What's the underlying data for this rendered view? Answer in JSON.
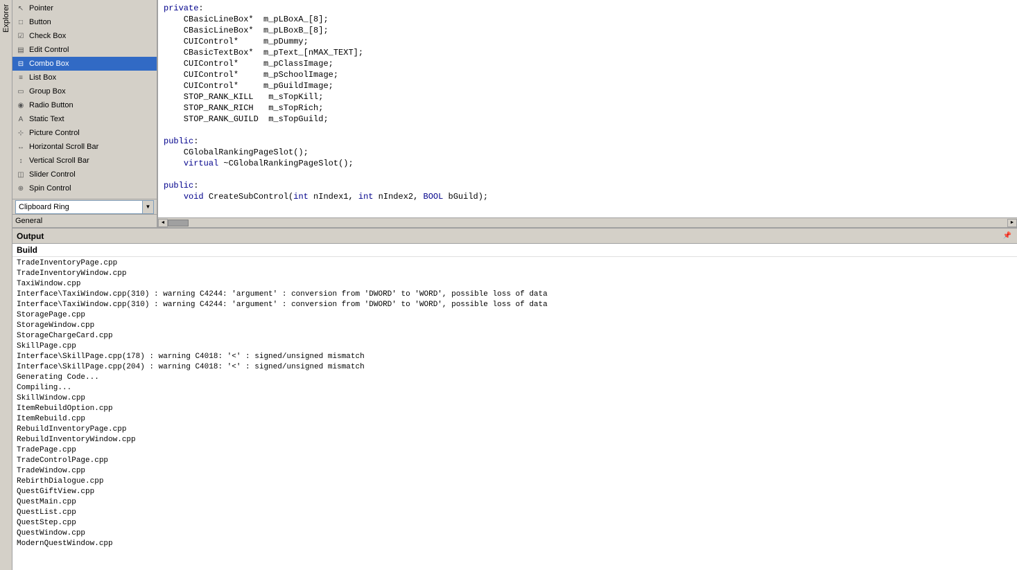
{
  "sidebar": {
    "items": [
      {
        "id": "pointer",
        "label": "Pointer",
        "icon": "↖",
        "selected": false
      },
      {
        "id": "button",
        "label": "Button",
        "icon": "□",
        "selected": false
      },
      {
        "id": "check-box",
        "label": "Check Box",
        "icon": "☑",
        "selected": false
      },
      {
        "id": "edit-control",
        "label": "Edit Control",
        "icon": "▤",
        "selected": false
      },
      {
        "id": "combo-box",
        "label": "Combo Box",
        "icon": "⊟",
        "selected": true
      },
      {
        "id": "list-box",
        "label": "List Box",
        "icon": "≡",
        "selected": false
      },
      {
        "id": "group-box",
        "label": "Group Box",
        "icon": "▭",
        "selected": false
      },
      {
        "id": "radio-button",
        "label": "Radio Button",
        "icon": "◉",
        "selected": false
      },
      {
        "id": "static-text",
        "label": "Static Text",
        "icon": "A",
        "selected": false
      },
      {
        "id": "picture-control",
        "label": "Picture Control",
        "icon": "⊹",
        "selected": false
      },
      {
        "id": "horizontal-scroll",
        "label": "Horizontal Scroll Bar",
        "icon": "↔",
        "selected": false
      },
      {
        "id": "vertical-scroll",
        "label": "Vertical Scroll Bar",
        "icon": "↕",
        "selected": false
      },
      {
        "id": "slider-control",
        "label": "Slider Control",
        "icon": "◫",
        "selected": false
      },
      {
        "id": "spin-control",
        "label": "Spin Control",
        "icon": "⊕",
        "selected": false
      }
    ],
    "clipboard_ring_label": "Clipboard Ring",
    "clipboard_ring_value": "Clipboard Ring",
    "general_label": "General",
    "left_tab": "Explorer"
  },
  "code": {
    "lines": [
      {
        "type": "keyword",
        "text": "private:"
      },
      {
        "type": "normal",
        "text": "    CBasicLineBox*  m_pLBoxA_[8];"
      },
      {
        "type": "normal",
        "text": "    CBasicLineBox*  m_pLBoxB_[8];"
      },
      {
        "type": "normal",
        "text": "    CUIControl*     m_pDummy;"
      },
      {
        "type": "normal",
        "text": "    CBasicTextBox*  m_pText_[nMAX_TEXT];"
      },
      {
        "type": "normal",
        "text": "    CUIControl*     m_pClassImage;"
      },
      {
        "type": "normal",
        "text": "    CUIControl*     m_pSchoolImage;"
      },
      {
        "type": "normal",
        "text": "    CUIControl*     m_pGuildImage;"
      },
      {
        "type": "normal",
        "text": "    STOP_RANK_KILL   m_sTopKill;"
      },
      {
        "type": "normal",
        "text": "    STOP_RANK_RICH   m_sTopRich;"
      },
      {
        "type": "normal",
        "text": "    STOP_RANK_GUILD  m_sTopGuild;"
      },
      {
        "type": "blank",
        "text": ""
      },
      {
        "type": "keyword",
        "text": "public:"
      },
      {
        "type": "normal",
        "text": "    CGlobalRankingPageSlot();"
      },
      {
        "type": "normal",
        "text": "    virtual ~CGlobalRankingPageSlot();"
      },
      {
        "type": "blank",
        "text": ""
      },
      {
        "type": "keyword",
        "text": "public:"
      },
      {
        "type": "normal",
        "text": "    void CreateSubControl(int nIndex1, int nIndex2, BOOL bGuild);"
      }
    ]
  },
  "output": {
    "title": "Output",
    "build_label": "Build",
    "pin_icon": "📌",
    "log_lines": [
      "TradeInventoryPage.cpp",
      "TradeInventoryWindow.cpp",
      "TaxiWindow.cpp",
      "Interface\\TaxiWindow.cpp(310) : warning C4244: 'argument' : conversion from 'DWORD' to 'WORD', possible loss of data",
      "Interface\\TaxiWindow.cpp(310) : warning C4244: 'argument' : conversion from 'DWORD' to 'WORD', possible loss of data",
      "StoragePage.cpp",
      "StorageWindow.cpp",
      "StorageChargeCard.cpp",
      "SkillPage.cpp",
      "Interface\\SkillPage.cpp(178) : warning C4018: '<' : signed/unsigned mismatch",
      "Interface\\SkillPage.cpp(204) : warning C4018: '<' : signed/unsigned mismatch",
      "Generating Code...",
      "Compiling...",
      "SkillWindow.cpp",
      "ItemRebuildOption.cpp",
      "ItemRebuild.cpp",
      "RebuildInventoryPage.cpp",
      "RebuildInventoryWindow.cpp",
      "TradePage.cpp",
      "TradeControlPage.cpp",
      "TradeWindow.cpp",
      "RebirthDialogue.cpp",
      "QuestGiftView.cpp",
      "QuestMain.cpp",
      "QuestList.cpp",
      "QuestStep.cpp",
      "QuestWindow.cpp",
      "ModernQuestWindow.cpp"
    ]
  }
}
